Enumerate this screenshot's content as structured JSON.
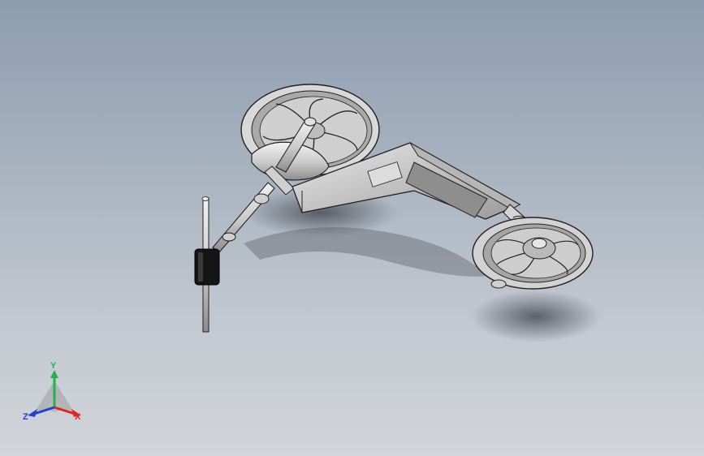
{
  "viewport": {
    "background_top": "#8d9cb0",
    "background_bottom": "#d2d5da",
    "model": "scooter-assembly"
  },
  "triad": {
    "x_label": "X",
    "y_label": "Y",
    "z_label": "Z",
    "x_color": "#e0261c",
    "y_color": "#22b14c",
    "z_color": "#1f3fd8"
  }
}
